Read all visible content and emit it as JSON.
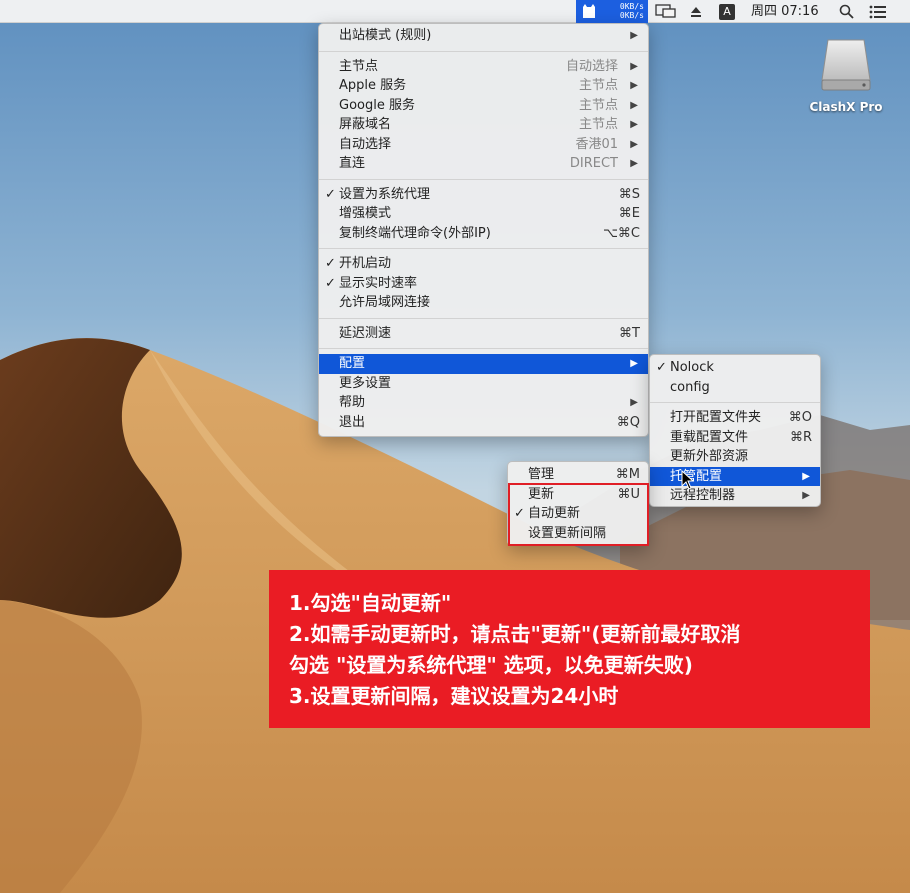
{
  "menubar": {
    "speed_up": "0KB/s",
    "speed_down": "0KB/s",
    "ime": "A",
    "clock": "周四 07:16"
  },
  "desktop": {
    "disk_label": "ClashX Pro"
  },
  "main_menu": {
    "outbound_mode": "出站模式 (规则)",
    "proxy_groups": [
      {
        "label": "主节点",
        "value": "自动选择"
      },
      {
        "label": "Apple 服务",
        "value": "主节点"
      },
      {
        "label": "Google 服务",
        "value": "主节点"
      },
      {
        "label": "屏蔽域名",
        "value": "主节点"
      },
      {
        "label": "自动选择",
        "value": "香港01"
      },
      {
        "label": "直连",
        "value": "DIRECT"
      }
    ],
    "system_proxy": {
      "label": "设置为系统代理",
      "shortcut": "⌘S",
      "checked": "✓"
    },
    "enhanced_mode": {
      "label": "增强模式",
      "shortcut": "⌘E"
    },
    "copy_shell": {
      "label": "复制终端代理命令(外部IP)",
      "shortcut": "⌥⌘C"
    },
    "launch_login": {
      "label": "开机启动",
      "checked": "✓"
    },
    "show_speed": {
      "label": "显示实时速率",
      "checked": "✓"
    },
    "allow_lan": {
      "label": "允许局域网连接"
    },
    "latency_test": {
      "label": "延迟测速",
      "shortcut": "⌘T"
    },
    "config": {
      "label": "配置"
    },
    "more_settings": {
      "label": "更多设置"
    },
    "help": {
      "label": "帮助"
    },
    "quit": {
      "label": "退出",
      "shortcut": "⌘Q"
    }
  },
  "config_menu": {
    "profiles": [
      {
        "label": "Nolock",
        "checked": "✓"
      },
      {
        "label": "config",
        "checked": ""
      }
    ],
    "open_folder": {
      "label": "打开配置文件夹",
      "shortcut": "⌘O"
    },
    "reload": {
      "label": "重载配置文件",
      "shortcut": "⌘R"
    },
    "update_external": {
      "label": "更新外部资源"
    },
    "managed": {
      "label": "托管配置"
    },
    "remote_controller": {
      "label": "远程控制器"
    }
  },
  "managed_menu": {
    "manage": {
      "label": "管理",
      "shortcut": "⌘M"
    },
    "update": {
      "label": "更新",
      "shortcut": "⌘U"
    },
    "auto_update": {
      "label": "自动更新",
      "checked": "✓"
    },
    "update_interval": {
      "label": "设置更新间隔"
    }
  },
  "annotation": {
    "line1": "1.勾选\"自动更新\"",
    "line2": "2.如需手动更新时，请点击\"更新\"(更新前最好取消",
    "line3": "勾选 \"设置为系统代理\" 选项，以免更新失败)",
    "line4": "3.设置更新间隔，建议设置为24小时"
  },
  "colors": {
    "accent": "#1057d8",
    "annotation_bg": "#ea1c24",
    "highlight_border": "#e01e26"
  }
}
